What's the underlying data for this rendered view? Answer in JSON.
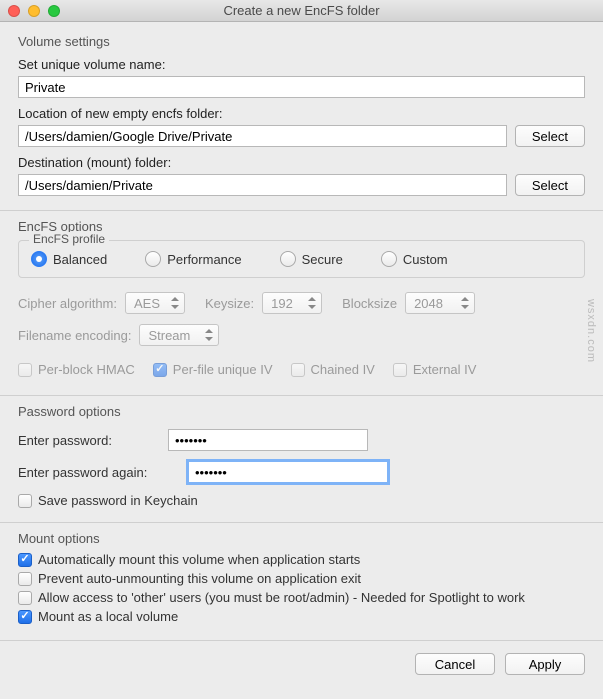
{
  "window": {
    "title": "Create a new EncFS folder"
  },
  "volume": {
    "group_label": "Volume settings",
    "name_label": "Set unique volume name:",
    "name_value": "Private",
    "location_label": "Location of new empty encfs folder:",
    "location_value": "/Users/damien/Google Drive/Private",
    "destination_label": "Destination (mount) folder:",
    "destination_value": "/Users/damien/Private",
    "select_button": "Select"
  },
  "encfs": {
    "group_label": "EncFS options",
    "profile_legend": "EncFS profile",
    "profiles": {
      "balanced": "Balanced",
      "performance": "Performance",
      "secure": "Secure",
      "custom": "Custom"
    },
    "selected_profile": "balanced",
    "cipher_label": "Cipher algorithm:",
    "cipher_value": "AES",
    "keysize_label": "Keysize:",
    "keysize_value": "192",
    "blocksize_label": "Blocksize",
    "blocksize_value": "2048",
    "filename_label": "Filename encoding:",
    "filename_value": "Stream",
    "hmac": {
      "per_block": "Per-block HMAC",
      "per_file": "Per-file unique IV",
      "chained": "Chained IV",
      "external": "External IV"
    },
    "hmac_checked": {
      "per_block": false,
      "per_file": true,
      "chained": false,
      "external": false
    }
  },
  "password": {
    "group_label": "Password options",
    "enter_label": "Enter password:",
    "enter_value": "•••••••",
    "again_label": "Enter password again:",
    "again_value": "•••••••",
    "keychain_label": "Save password in Keychain",
    "keychain_checked": false
  },
  "mount": {
    "group_label": "Mount options",
    "auto_mount": "Automatically mount this volume when application starts",
    "prevent_unmount": "Prevent auto-unmounting this volume on application exit",
    "allow_other": "Allow access to 'other' users (you must be root/admin) - Needed for Spotlight to work",
    "local_volume": "Mount as a local volume",
    "checked": {
      "auto_mount": true,
      "prevent_unmount": false,
      "allow_other": false,
      "local_volume": true
    }
  },
  "footer": {
    "cancel": "Cancel",
    "apply": "Apply"
  },
  "watermark": "wsxdn.com"
}
